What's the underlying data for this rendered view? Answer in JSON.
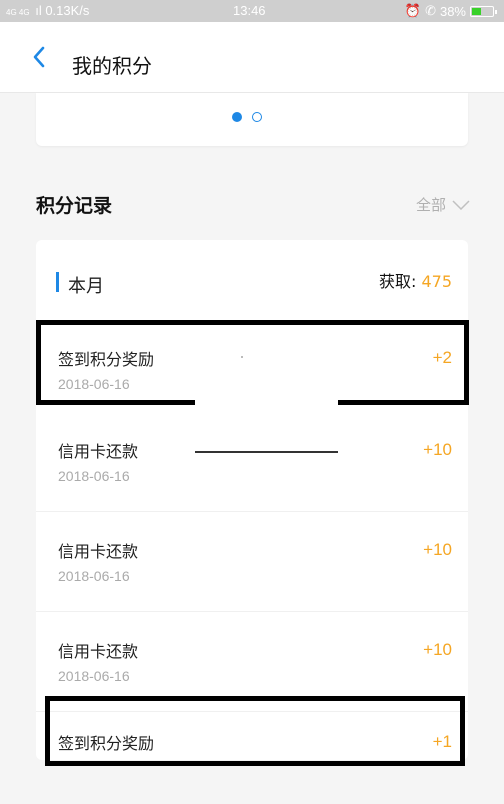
{
  "status_bar": {
    "network": "4G 4G",
    "speed": "0.13K/s",
    "time": "13:46",
    "battery": "38%",
    "battery_color": "#39d12a"
  },
  "header": {
    "back_icon": "chevron-left-icon",
    "title": "我的积分"
  },
  "carousel": {
    "active_index": 0,
    "count": 2
  },
  "records": {
    "section_title": "积分记录",
    "filter_label": "全部",
    "month_label": "本月",
    "earned_label": "获取:",
    "earned_value": "475",
    "items": [
      {
        "label": "签到积分奖励",
        "date": "2018-06-16",
        "points": "+2"
      },
      {
        "label": "信用卡还款",
        "date": "2018-06-16",
        "points": "+10"
      },
      {
        "label": "信用卡还款",
        "date": "2018-06-16",
        "points": "+10"
      },
      {
        "label": "信用卡还款",
        "date": "2018-06-16",
        "points": "+10"
      },
      {
        "label": "签到积分奖励",
        "date": "",
        "points": "+1"
      }
    ]
  },
  "colors": {
    "accent_blue": "#1e88e5",
    "points_orange": "#f5a623"
  }
}
